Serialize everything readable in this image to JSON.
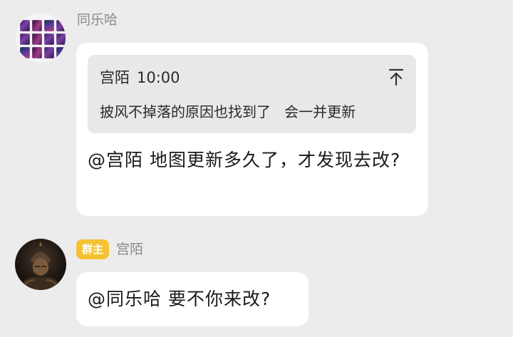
{
  "messages": [
    {
      "sender": "同乐哈",
      "avatar": "game-art-collage-avatar",
      "quote": {
        "author": "宫陌",
        "time": "10:00",
        "text": "披风不掉落的原因也找到了   会一并更新",
        "jump_icon": "jump-to-top-icon"
      },
      "text": "@宫陌 地图更新多久了，才发现去改?"
    },
    {
      "sender": "宫陌",
      "badge": "群主",
      "avatar": "warrior-portrait-avatar",
      "text": "@同乐哈 要不你来改?"
    }
  ],
  "colors": {
    "background": "#ececec",
    "bubble": "#ffffff",
    "quote_bg": "#e8e8e8",
    "badge_bg": "#f4c234",
    "name_gray": "#8a8a8a"
  }
}
